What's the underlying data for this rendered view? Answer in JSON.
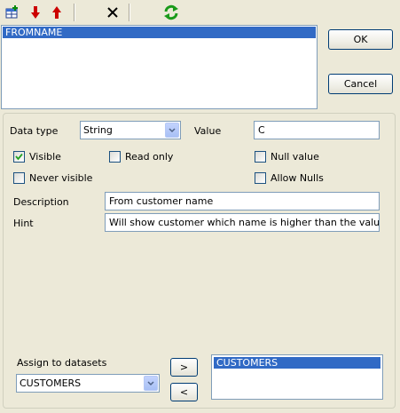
{
  "toolbar": {
    "icons": [
      "add-field-icon",
      "move-down-icon",
      "move-up-icon",
      "delete-icon",
      "refresh-icon"
    ]
  },
  "parameter_list": {
    "items": [
      "FROMNAME"
    ],
    "selected": "FROMNAME"
  },
  "buttons": {
    "ok": "OK",
    "cancel": "Cancel",
    "add": ">",
    "remove": "<"
  },
  "form": {
    "data_type_label": "Data type",
    "data_type_value": "String",
    "value_label": "Value",
    "value": "C",
    "visible_label": "Visible",
    "visible_checked": true,
    "read_only_label": "Read only",
    "read_only_checked": false,
    "null_value_label": "Null value",
    "null_value_checked": false,
    "never_visible_label": "Never visible",
    "never_visible_checked": false,
    "allow_nulls_label": "Allow Nulls",
    "allow_nulls_checked": false,
    "description_label": "Description",
    "description_value": "From customer name",
    "hint_label": "Hint",
    "hint_value": "Will show customer which name is higher than the value"
  },
  "datasets": {
    "assign_label": "Assign to datasets",
    "selected_dataset": "CUSTOMERS",
    "assigned_items": [
      "CUSTOMERS"
    ]
  },
  "colors": {
    "selection": "#316ac5",
    "window_bg": "#ece9d8",
    "delete_accent": "#000000",
    "arrow_red": "#cc0000",
    "refresh_green": "#1a9a1a"
  }
}
